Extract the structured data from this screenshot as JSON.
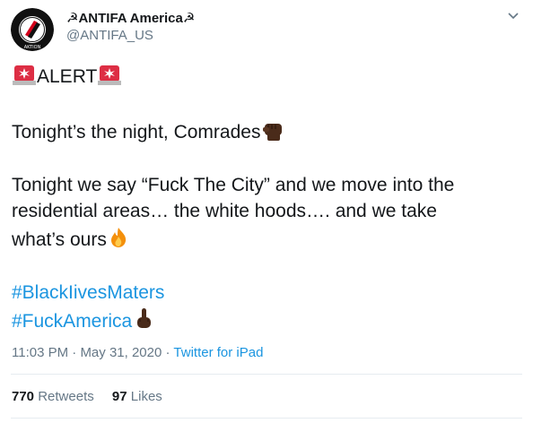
{
  "user": {
    "display_name": "☭ANTIFA America☭",
    "handle": "@ANTIFA_US",
    "avatar_icon": "antifa-flag-logo-icon"
  },
  "tweet": {
    "lines": {
      "alert": "ALERT",
      "l1": "Tonight’s the night, Comrades",
      "l2": "Tonight we say “Fuck The City” and we move into the",
      "l3": "residential areas… the white hoods…. and we take",
      "l4": "what’s ours",
      "hashtag1": "#BlackIivesMaters",
      "hashtag2": "#FuckAmerica"
    },
    "emojis": [
      "police-light-icon",
      "raised-fist-icon",
      "fire-icon",
      "middle-finger-icon"
    ]
  },
  "meta": {
    "time": "11:03 PM",
    "sep": " · ",
    "date": "May 31, 2020",
    "source": "Twitter for iPad"
  },
  "stats": {
    "retweets_count": "770",
    "retweets_label": "Retweets",
    "likes_count": "97",
    "likes_label": "Likes"
  },
  "colors": {
    "link": "#1b95e0",
    "secondary": "#657786",
    "divider": "#e6ecf0",
    "text": "#14171a"
  }
}
